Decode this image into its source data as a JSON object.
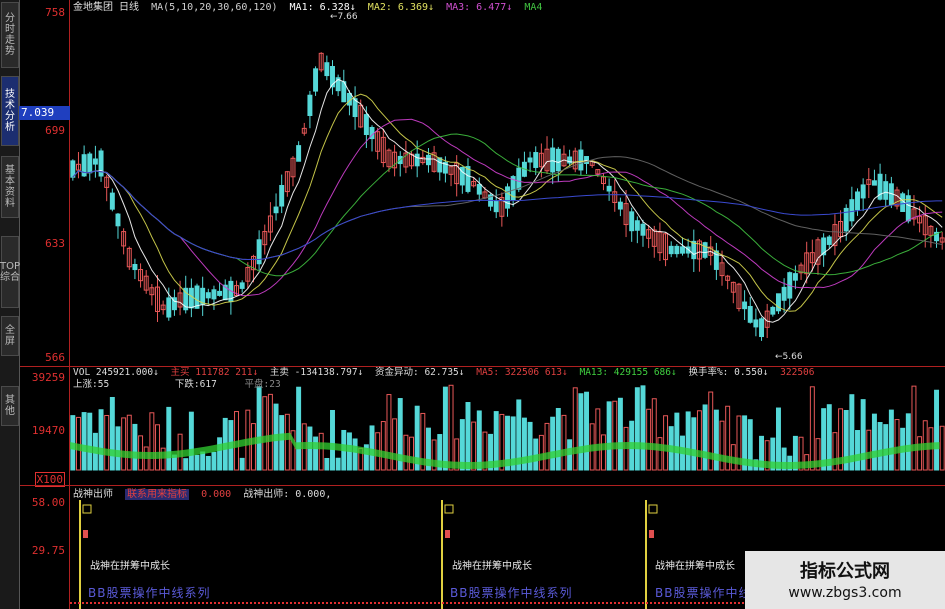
{
  "sidebar": {
    "tabs": [
      {
        "label": "分时走势",
        "active": false
      },
      {
        "label": "技术分析",
        "active": true
      },
      {
        "label": "基本资料",
        "active": false
      },
      {
        "label": "TOP综合",
        "active": false
      },
      {
        "label": "全屏",
        "active": false
      },
      {
        "label": "其他",
        "active": false
      }
    ]
  },
  "price_panel": {
    "title": "金地集团 日线",
    "ma_params": "MA(5,10,20,30,60,120)",
    "ma1": "MA1: 6.328↓",
    "ma2": "MA2: 6.369↓",
    "ma3": "MA3: 6.477↓",
    "ma4": "MA4",
    "high_mark": "←7.66",
    "low_mark": "←5.66",
    "axis_labels": [
      "758",
      "699",
      "633",
      "566"
    ],
    "current_price": "7.039"
  },
  "volume_panel": {
    "vol": "VOL 245921.000↓",
    "main_buy": "主买  111782 211↓",
    "main_sell": "主卖  -134138.797↓",
    "fund_move": "资金异动: 62.735↓",
    "ma5": "MA5: 322506 613↓",
    "ma13": "MA13: 429155 686↓",
    "turnover": "换手率%: 0.550↓",
    "tail": "322506",
    "up_count": "上涨:55",
    "down_count": "下跌:617",
    "flat_count": "平盘:23",
    "axis_labels": [
      "39259",
      "19470"
    ],
    "unit": "X100"
  },
  "indicator_panel": {
    "name": "战神出师",
    "formula": "联系用来指标",
    "value1": "0.000",
    "value2": "战神出师: 0.000,",
    "axis_labels": [
      "58.00",
      "29.75"
    ],
    "caption": "战神在拼筹中成长",
    "series_name": "BB股票操作中线系列"
  },
  "watermark": {
    "title": "指标公式网",
    "url": "www.zbgs3.com"
  },
  "colors": {
    "up": "#e85858",
    "down": "#55d8d8",
    "grid": "#b02020",
    "ma5": "#ffffff",
    "ma10": "#d8d850",
    "ma20": "#d040d0",
    "ma30": "#40c040",
    "ma60": "#6a6a6a",
    "ma120": "#3a4ad0",
    "ma_vol_green": "#30d030"
  }
}
